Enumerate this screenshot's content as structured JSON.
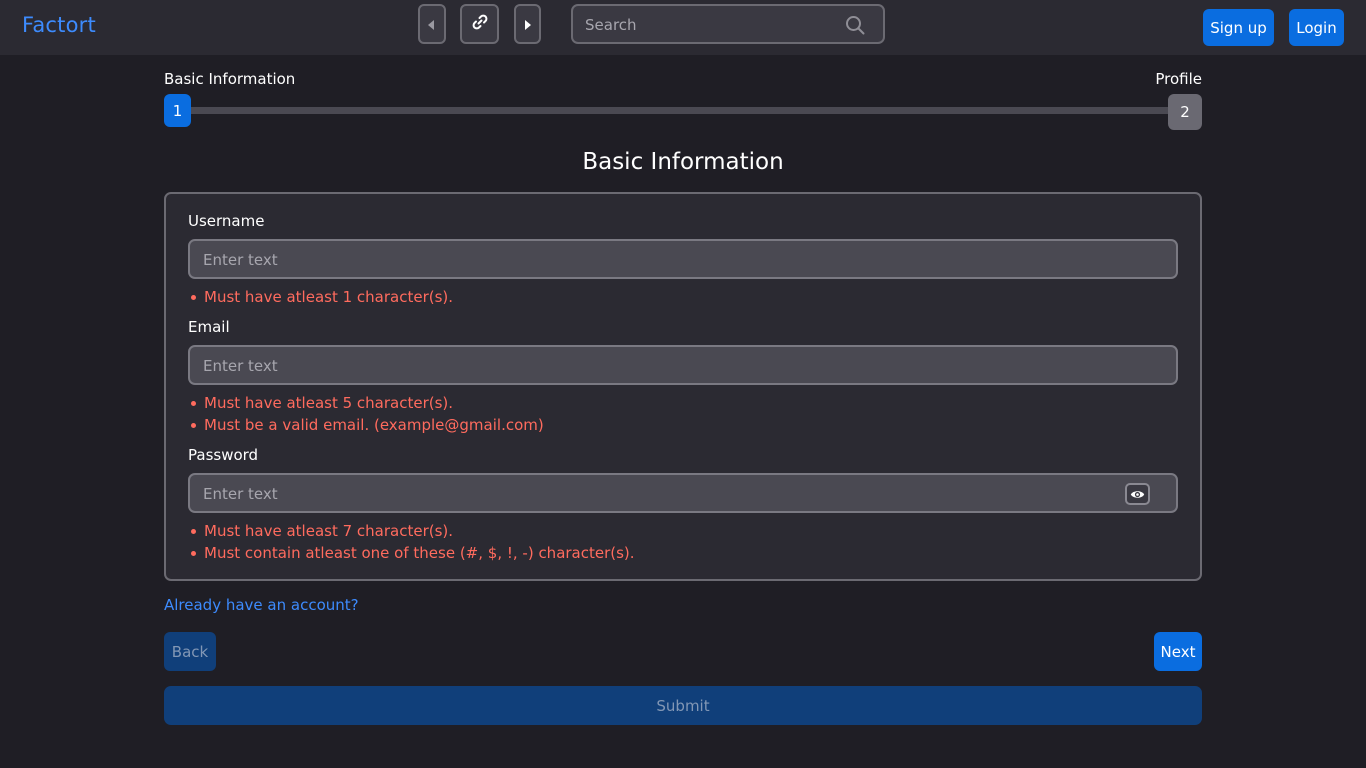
{
  "header": {
    "brand": "Factort",
    "search_placeholder": "Search",
    "signup_label": "Sign up",
    "login_label": "Login"
  },
  "stepper": {
    "steps": [
      {
        "label": "Basic Information",
        "number": "1",
        "state": "active"
      },
      {
        "label": "Profile",
        "number": "2",
        "state": "inactive"
      }
    ]
  },
  "form": {
    "title": "Basic Information",
    "fields": [
      {
        "label": "Username",
        "placeholder": "Enter text",
        "value": "",
        "errors": [
          "Must have atleast 1 character(s)."
        ]
      },
      {
        "label": "Email",
        "placeholder": "Enter text",
        "value": "",
        "errors": [
          "Must have atleast 5 character(s).",
          "Must be a valid email. (example@gmail.com)"
        ]
      },
      {
        "label": "Password",
        "placeholder": "Enter text",
        "value": "",
        "errors": [
          "Must have atleast 7 character(s).",
          "Must contain atleast one of these (#, $, !, -) character(s)."
        ]
      }
    ]
  },
  "actions": {
    "account_link": "Already have an account?",
    "back_label": "Back",
    "next_label": "Next",
    "submit_label": "Submit"
  },
  "colors": {
    "accent": "#0a6de0",
    "brand": "#3d8bfd",
    "error": "#ff6b5e",
    "disabled_button": "#103f7a"
  }
}
